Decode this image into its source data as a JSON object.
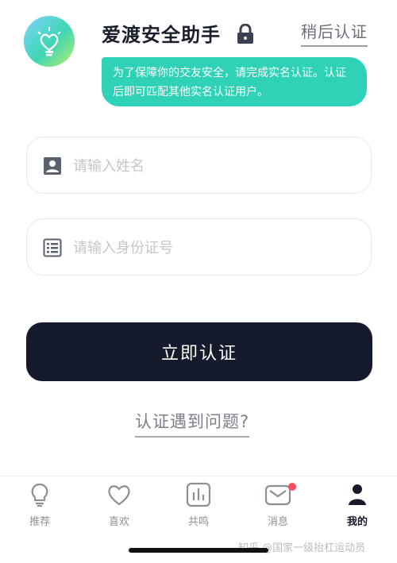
{
  "header": {
    "title": "爱渡安全助手",
    "later_label": "稍后认证",
    "message": "为了保障你的交友安全，请完成实名认证。认证后即可匹配其他实名认证用户。"
  },
  "form": {
    "name_placeholder": "请输入姓名",
    "id_placeholder": "请输入身份证号",
    "submit_label": "立即认证",
    "problem_link": "认证遇到问题?"
  },
  "tabbar": {
    "items": [
      {
        "label": "推荐",
        "icon": "lightbulb-icon"
      },
      {
        "label": "喜欢",
        "icon": "heart-icon"
      },
      {
        "label": "共鸣",
        "icon": "bar-chart-icon"
      },
      {
        "label": "消息",
        "icon": "mail-icon",
        "badge": true
      },
      {
        "label": "我的",
        "icon": "user-icon",
        "active": true
      }
    ]
  },
  "watermark": "知乎 @国家一级抬杠运动员",
  "colors": {
    "accent_teal": "#2fd2b6",
    "primary_dark": "#151a2c",
    "badge_red": "#ff4d5a"
  }
}
